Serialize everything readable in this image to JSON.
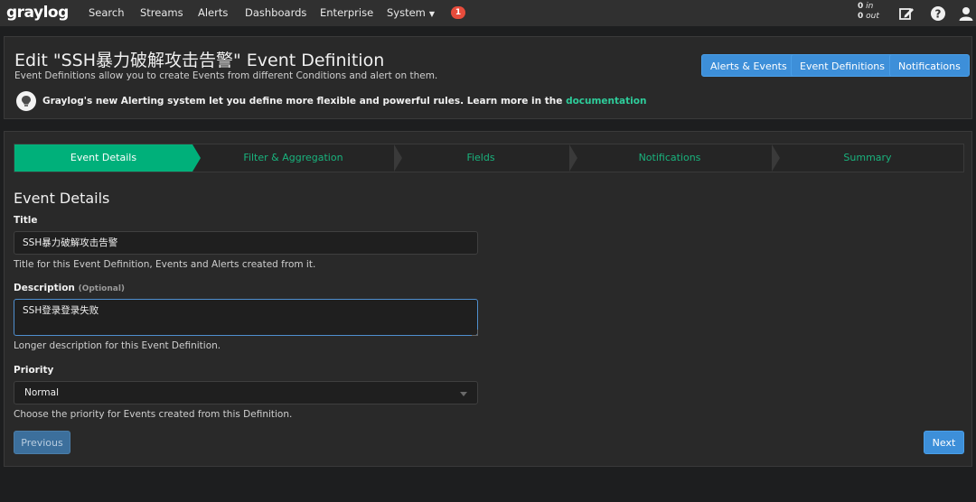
{
  "nav": {
    "brand": "graylog",
    "items": [
      "Search",
      "Streams",
      "Alerts",
      "Dashboards",
      "Enterprise",
      "System"
    ],
    "notification_count": "1",
    "throughput_in": "0",
    "throughput_in_label": "in",
    "throughput_out": "0",
    "throughput_out_label": "out"
  },
  "header": {
    "title": "Edit \"SSH暴力破解攻击告警\" Event Definition",
    "subtitle": "Event Definitions allow you to create Events from different Conditions and alert on them.",
    "buttons": [
      "Alerts & Events",
      "Event Definitions",
      "Notifications"
    ],
    "info_text": "Graylog's new Alerting system let you define more flexible and powerful rules. Learn more in the ",
    "info_link": "documentation"
  },
  "steps": [
    "Event Details",
    "Filter & Aggregation",
    "Fields",
    "Notifications",
    "Summary"
  ],
  "form": {
    "section_title": "Event Details",
    "title_label": "Title",
    "title_value": "SSH暴力破解攻击告警",
    "title_help": "Title for this Event Definition, Events and Alerts created from it.",
    "description_label": "Description",
    "description_optional": "(Optional)",
    "description_value": "SSH登录登录失败",
    "description_help": "Longer description for this Event Definition.",
    "priority_label": "Priority",
    "priority_value": "Normal",
    "priority_help": "Choose the priority for Events created from this Definition.",
    "previous_label": "Previous",
    "next_label": "Next"
  },
  "colors": {
    "accent": "#00b07a",
    "button": "#3d8fd9",
    "badge": "#e74c3c",
    "link": "#2ecc9a"
  }
}
